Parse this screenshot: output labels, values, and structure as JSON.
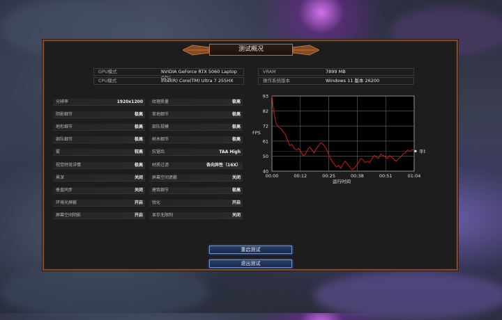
{
  "dialog": {
    "title": "测试概况"
  },
  "info": [
    {
      "label": "GPU模式",
      "value": "NVIDIA GeForce RTX 5060 Laptop GPU"
    },
    {
      "label": "CPU模式",
      "value": "Intel(R) Core(TM) Ultra 7 255HX"
    },
    {
      "label": "VRAM",
      "value": "7899 MB"
    },
    {
      "label": "操作系统版本",
      "value": "Windows 11 版本 26200"
    }
  ],
  "settings_left": [
    {
      "label": "分辨率",
      "value": "1920x1200"
    },
    {
      "label": "阴影细节",
      "value": "极高"
    },
    {
      "label": "地形细节",
      "value": "极高"
    },
    {
      "label": "部队细节",
      "value": "极高"
    },
    {
      "label": "雾",
      "value": "较高"
    },
    {
      "label": "视觉特效详情",
      "value": "极高"
    },
    {
      "label": "景深",
      "value": "关闭"
    },
    {
      "label": "垂直同步",
      "value": "关闭"
    },
    {
      "label": "环境光屏蔽",
      "value": "开启"
    },
    {
      "label": "屏幕空间阴影",
      "value": "开启"
    }
  ],
  "settings_right": [
    {
      "label": "纹理质量",
      "value": "极高"
    },
    {
      "label": "草地细节",
      "value": "极高"
    },
    {
      "label": "部队规模",
      "value": "极高"
    },
    {
      "label": "树木细节",
      "value": "极高"
    },
    {
      "label": "抗锯齿",
      "value": "TAA High"
    },
    {
      "label": "材质过滤",
      "value": "各向异性（16X）"
    },
    {
      "label": "屏幕空间遮蔽",
      "value": "关闭"
    },
    {
      "label": "建筑细节",
      "value": "极高"
    },
    {
      "label": "锐化",
      "value": "开启"
    },
    {
      "label": "显存无限制",
      "value": "关闭"
    }
  ],
  "chart_data": {
    "type": "line",
    "ylabel": "FPS",
    "xlabel": "运行时间",
    "ylim": [
      40,
      93
    ],
    "yticks": [
      "93",
      "82",
      "72",
      "61",
      "50",
      "40"
    ],
    "xticks": [
      "00:00",
      "00:12",
      "00:25",
      "00:38",
      "00:51",
      "01:04"
    ],
    "xlim_seconds": [
      0,
      64
    ],
    "grid": true,
    "series_color": "#d01818",
    "average": {
      "label": "平均FPS：54.1",
      "value": 54.1
    },
    "points": [
      [
        0,
        93
      ],
      [
        1,
        80
      ],
      [
        2,
        73
      ],
      [
        3,
        71
      ],
      [
        4,
        70
      ],
      [
        5,
        68
      ],
      [
        6,
        66
      ],
      [
        7,
        62
      ],
      [
        8,
        58
      ],
      [
        9,
        59
      ],
      [
        10,
        56
      ],
      [
        11,
        55
      ],
      [
        12,
        56
      ],
      [
        13,
        54
      ],
      [
        14,
        51
      ],
      [
        15,
        52
      ],
      [
        16,
        55
      ],
      [
        17,
        57
      ],
      [
        18,
        55
      ],
      [
        19,
        53
      ],
      [
        20,
        56
      ],
      [
        21,
        58
      ],
      [
        22,
        60
      ],
      [
        23,
        59
      ],
      [
        24,
        57
      ],
      [
        25,
        54
      ],
      [
        26,
        50
      ],
      [
        27,
        47
      ],
      [
        28,
        45
      ],
      [
        29,
        43
      ],
      [
        30,
        44
      ],
      [
        31,
        42
      ],
      [
        32,
        45
      ],
      [
        33,
        47
      ],
      [
        34,
        45
      ],
      [
        35,
        43
      ],
      [
        36,
        41
      ],
      [
        37,
        42
      ],
      [
        38,
        44
      ],
      [
        39,
        46
      ],
      [
        40,
        49
      ],
      [
        41,
        48
      ],
      [
        42,
        46
      ],
      [
        43,
        47
      ],
      [
        44,
        46
      ],
      [
        45,
        49
      ],
      [
        46,
        51
      ],
      [
        47,
        50
      ],
      [
        48,
        49
      ],
      [
        49,
        52
      ],
      [
        50,
        51
      ],
      [
        51,
        50
      ],
      [
        52,
        49
      ],
      [
        53,
        51
      ],
      [
        54,
        50
      ],
      [
        55,
        48
      ],
      [
        56,
        47
      ],
      [
        57,
        49
      ],
      [
        58,
        50
      ],
      [
        59,
        52
      ],
      [
        60,
        53
      ],
      [
        61,
        55
      ],
      [
        62,
        54
      ],
      [
        63,
        55
      ],
      [
        64,
        55
      ]
    ]
  },
  "buttons": {
    "restart": "重启测试",
    "exit": "退出测试"
  },
  "colors": {
    "accent_border": "#7a4c2a",
    "button_border": "#6f8fd0",
    "series": "#d01818"
  }
}
